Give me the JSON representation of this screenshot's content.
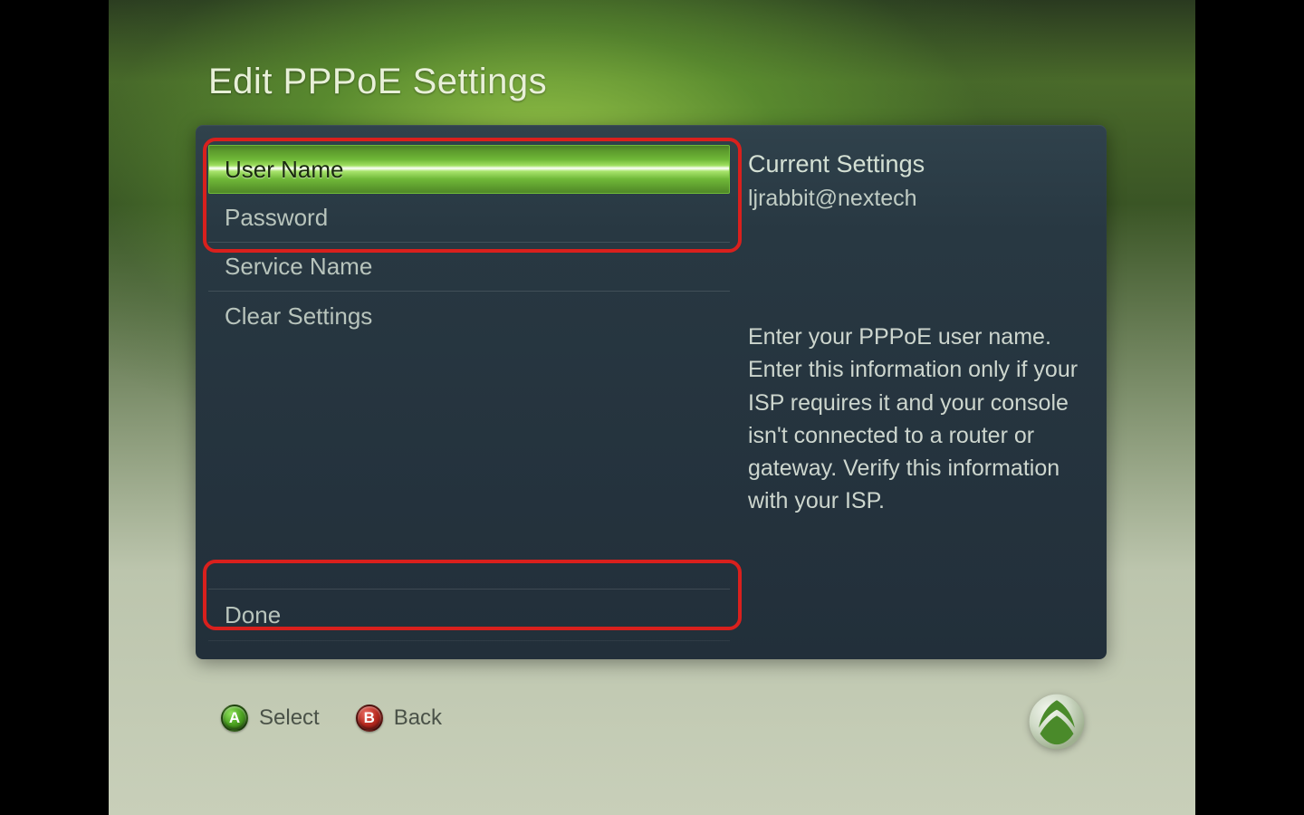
{
  "page": {
    "title": "Edit PPPoE Settings"
  },
  "menu": {
    "items": [
      {
        "label": "User Name",
        "selected": true
      },
      {
        "label": "Password",
        "selected": false
      },
      {
        "label": "Service Name",
        "selected": false
      },
      {
        "label": "Clear Settings",
        "selected": false
      }
    ],
    "done_label": "Done"
  },
  "info": {
    "heading": "Current Settings",
    "value": "ljrabbit@nextech",
    "description": "Enter your PPPoE user name. Enter this information only if your ISP requires it and your console isn't connected to a router or gateway. Verify this information with your ISP."
  },
  "footer": {
    "select": {
      "glyph": "A",
      "label": "Select"
    },
    "back": {
      "glyph": "B",
      "label": "Back"
    }
  }
}
